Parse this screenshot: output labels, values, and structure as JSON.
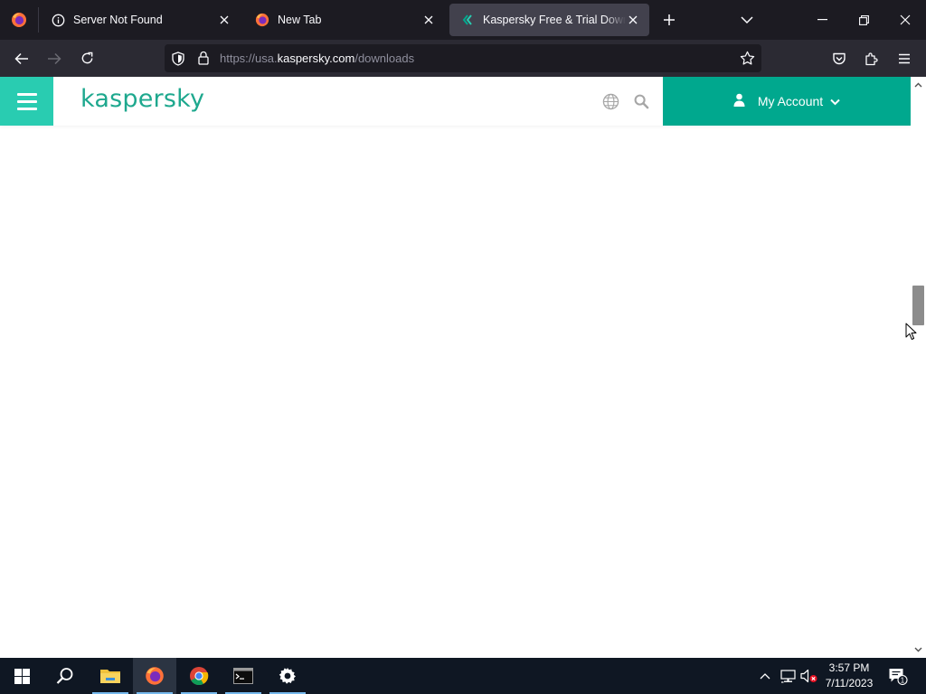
{
  "browser": {
    "tabs": [
      {
        "title": "Server Not Found",
        "icon": "info-icon",
        "active": false
      },
      {
        "title": "New Tab",
        "icon": "firefox-icon",
        "active": false
      },
      {
        "title": "Kaspersky Free & Trial Downloads",
        "icon": "kaspersky-favicon",
        "active": true
      }
    ],
    "url": {
      "prefix": "https://usa.",
      "domain": "kaspersky.com",
      "path": "/downloads"
    }
  },
  "site": {
    "logo_text": "kaspersky",
    "account_label": "My Account",
    "brand_colors": {
      "primary": "#00a88e",
      "light": "#29ccb1",
      "logo": "#1ea88e"
    }
  },
  "scrollbar": {
    "position_fraction": 0.38
  },
  "taskbar": {
    "apps": [
      "start-icon",
      "search-icon",
      "file-explorer-icon",
      "firefox-icon",
      "chrome-icon",
      "terminal-icon",
      "settings-icon"
    ],
    "clock_time": "3:57 PM",
    "clock_date": "7/11/2023",
    "notification_count": "1"
  }
}
